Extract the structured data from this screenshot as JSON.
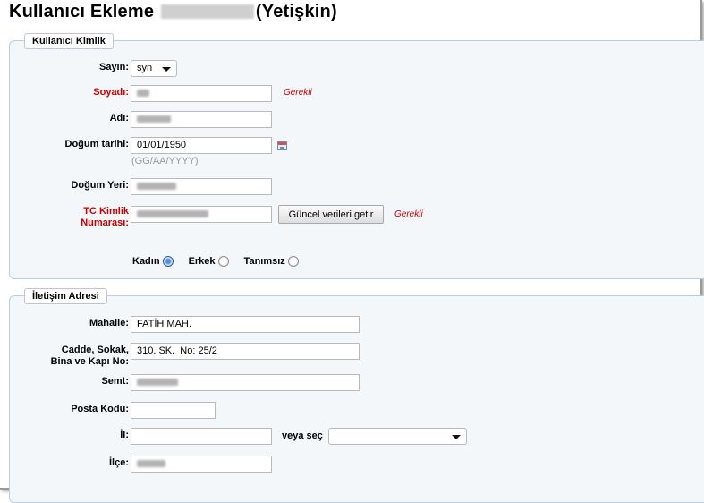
{
  "page": {
    "title_left": "Kullanıcı Ekleme",
    "title_right": "(Yetişkin)"
  },
  "identity": {
    "legend": "Kullanıcı Kimlik",
    "salutation_label": "Sayın:",
    "salutation_value": "syn",
    "surname_label": "Soyadı:",
    "name_label": "Adı:",
    "birthdate_label": "Doğum tarihi:",
    "birthdate_value": "01/01/1950",
    "birthdate_hint": "(GG/AA/YYYY)",
    "birthplace_label": "Doğum Yeri:",
    "tc_label_line1": "TC Kimlik",
    "tc_label_line2": "Numarası:",
    "fetch_button": "Güncel verileri getir",
    "required": "Gerekli",
    "gender_female": "Kadın",
    "gender_male": "Erkek",
    "gender_unknown": "Tanımsız",
    "gender_selected": "Kadın"
  },
  "address": {
    "legend": "İletişim Adresi",
    "neighborhood_label": "Mahalle:",
    "neighborhood_value": "FATİH MAH.",
    "street_label_line1": "Cadde, Sokak,",
    "street_label_line2": "Bina ve Kapı No:",
    "street_value": "310. SK.  No: 25/2",
    "district_label": "Semt:",
    "postal_label": "Posta Kodu:",
    "province_label": "İl:",
    "or_choose": "veya seç",
    "county_label": "İlçe:"
  },
  "colors": {
    "required": "#cc0000",
    "fieldset_border": "#b8cfe0",
    "fieldset_bg": "#f4f7fa"
  }
}
